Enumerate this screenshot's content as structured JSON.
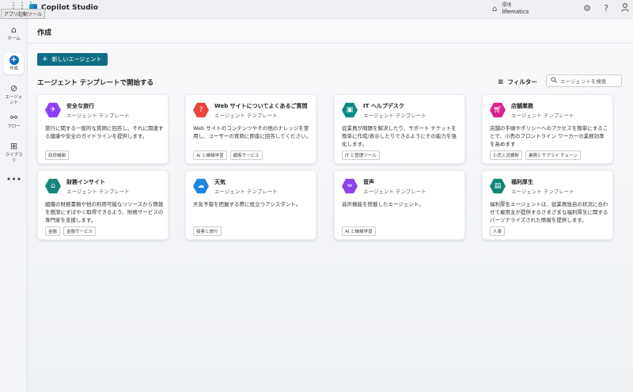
{
  "topbar": {
    "tooltip": "アプリ起動ツール",
    "app_name": "Copilot Studio",
    "env_label": "環境",
    "env_value": "lifematics",
    "icons": [
      "waffle-icon",
      "environment-icon",
      "settings-icon",
      "help-icon",
      "account-icon"
    ]
  },
  "rail": {
    "items": [
      {
        "label": "ホーム",
        "icon": "home-icon"
      },
      {
        "label": "作成",
        "icon": "create-icon",
        "active": true
      },
      {
        "label": "エージェント",
        "icon": "agents-icon"
      },
      {
        "label": "フロー",
        "icon": "flows-icon"
      },
      {
        "label": "ライブラリ",
        "icon": "library-icon"
      },
      {
        "label": "",
        "icon": "more-icon"
      }
    ]
  },
  "main": {
    "page_title": "作成",
    "new_agent_label": "新しいエージェント",
    "section_title": "エージェント テンプレートで開始する",
    "filter_label": "フィルター",
    "search_placeholder": "エージェントを検索"
  },
  "cards": [
    {
      "title": "安全な旅行",
      "subtitle": "エージェント テンプレート",
      "description": "旅行に関する一般的な質問に回答し、それに関連する健康や安全のガイドラインを提供します。",
      "tags": [
        "政府機関"
      ],
      "icon": "airplane-icon",
      "color": "#8a3ffc"
    },
    {
      "title": "Web サイトについてよくあるご質問",
      "subtitle": "エージェント テンプレート",
      "description": "Web サイトのコンテンツやその他のナレッジを使用し、ユーザーの質問に即座に回答してください。",
      "tags": [
        "AI と機械学習",
        "顧客サービス"
      ],
      "icon": "chat-question-icon",
      "color": "#e8463c"
    },
    {
      "title": "IT ヘルプデスク",
      "subtitle": "エージェント テンプレート",
      "description": "従業員が問題を解決したり、サポート チケットを簡単に作成/表示したりできるようにその能力を強化します。",
      "tags": [
        "IT と管理ツール"
      ],
      "icon": "monitor-icon",
      "color": "#0b8a83"
    },
    {
      "title": "店舗業務",
      "subtitle": "エージェント テンプレート",
      "description": "店舗の手順やポリシーへのアクセスを簡単にすることで、小売のフロントライン ワーカーの業務効率を高めます",
      "tags": [
        "小売と消費財",
        "業務とサプライ チェーン"
      ],
      "icon": "cart-icon",
      "color": "#d6248a"
    },
    {
      "title": "財務インサイト",
      "subtitle": "エージェント テンプレート",
      "description": "組織の財務書類や他の利用可能なリソースから情報を簡潔にすばやく取得できるよう、財務サービスの専門家を支援します。",
      "tags": [
        "金融",
        "金融サービス"
      ],
      "icon": "bank-icon",
      "color": "#18867a"
    },
    {
      "title": "天気",
      "subtitle": "エージェント テンプレート",
      "description": "天気予報を把握する際に役立つアシスタント。",
      "tags": [
        "接客と旅行"
      ],
      "icon": "weather-icon",
      "color": "#1a86e0"
    },
    {
      "title": "音声",
      "subtitle": "エージェント テンプレート",
      "description": "音声機能を搭載したエージェント。",
      "tags": [
        "AI と機械学習"
      ],
      "icon": "voice-chat-icon",
      "color": "#8b44e8"
    },
    {
      "title": "福利厚生",
      "subtitle": "エージェント テンプレート",
      "description": "福利厚生エージェントは、従業員独自の状況に合わせて雇用主が提供するさまざまな福利厚生に関するパーソナライズされた情報を提供します。",
      "tags": [
        "人事"
      ],
      "icon": "document-person-icon",
      "color": "#138575"
    }
  ]
}
